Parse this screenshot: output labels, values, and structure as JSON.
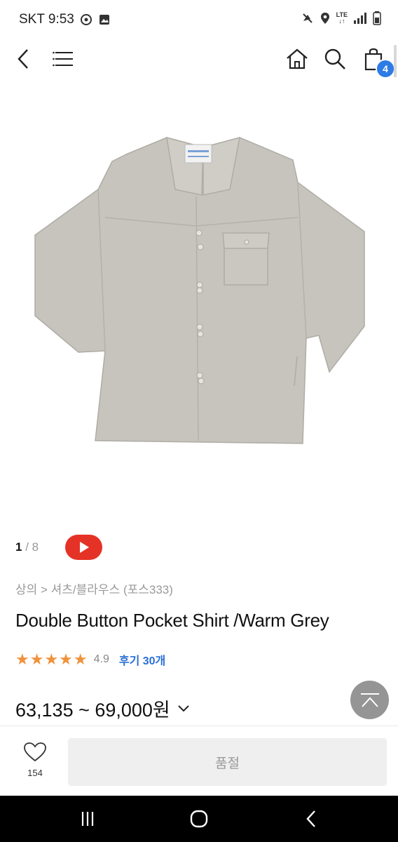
{
  "status_bar": {
    "carrier_time": "SKT 9:53",
    "network": "LTE"
  },
  "header": {
    "cart_count": "4"
  },
  "gallery": {
    "current": "1",
    "separator": "/",
    "total": "8"
  },
  "product": {
    "breadcrumb": "상의 > 셔츠/블라우스 (포스333)",
    "title": "Double Button Pocket Shirt /Warm Grey",
    "stars": "★★★★★",
    "rating": "4.9",
    "review_link": "후기 30개",
    "price": "63,135 ~ 69,000원"
  },
  "bottom": {
    "like_count": "154",
    "soldout_label": "품절"
  },
  "colors": {
    "accent_blue": "#2d7be5",
    "star_orange": "#f0923b",
    "youtube_red": "#e53226"
  }
}
